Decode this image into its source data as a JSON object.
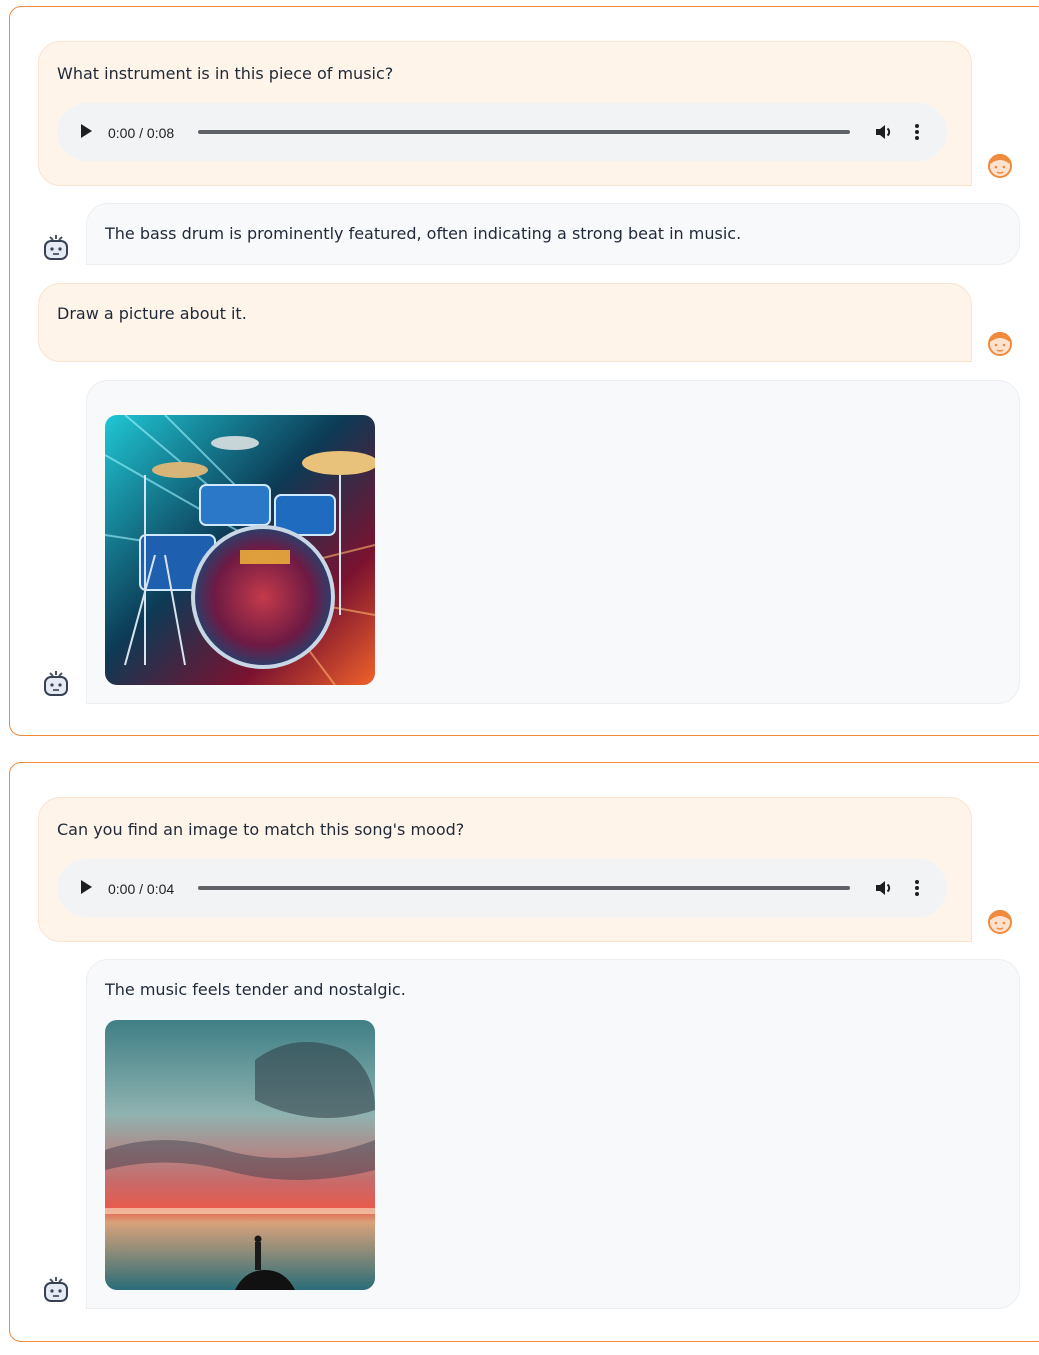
{
  "conversation1": {
    "msg1": {
      "text": "What instrument is in this piece of music?",
      "audio_time": "0:00 / 0:08"
    },
    "msg2": {
      "text": "The bass drum is prominently featured, often indicating a strong beat in music."
    },
    "msg3": {
      "text": "Draw a picture about it."
    },
    "msg4": {
      "image_alt": "drum kit illustration"
    }
  },
  "conversation2": {
    "msg1": {
      "text": "Can you find an image to match this song's mood?",
      "audio_time": "0:00 / 0:04"
    },
    "msg2": {
      "text": "The music feels tender and nostalgic.",
      "image_alt": "sunset seascape with lone figure"
    }
  },
  "colors": {
    "accent": "#f08a3c",
    "user_bubble": "#fff4ea",
    "bot_bubble": "#f8f9fb"
  }
}
